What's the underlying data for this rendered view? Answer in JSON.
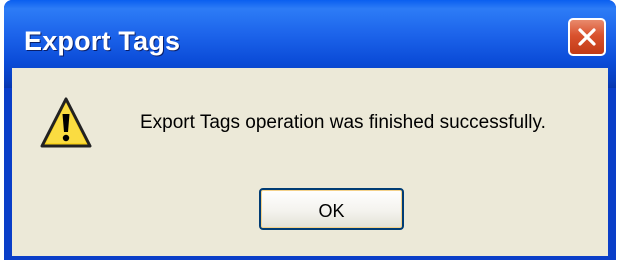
{
  "dialog": {
    "title": "Export Tags",
    "message": "Export Tags operation was finished successfully.",
    "icon": "warning-icon",
    "ok_label": "OK",
    "close_icon": "close-icon"
  },
  "colors": {
    "titlebar": "#0b4cd8",
    "body": "#ece9d8",
    "close_button": "#d9522e",
    "warning_yellow": "#f8d21c"
  }
}
